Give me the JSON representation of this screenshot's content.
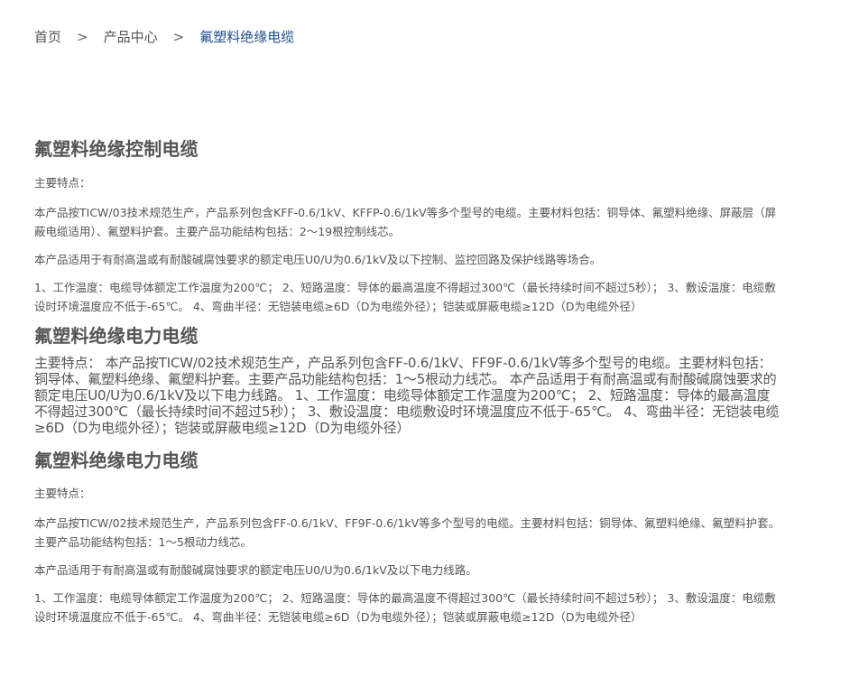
{
  "breadcrumb": {
    "home": "首页",
    "separator1": ">",
    "products": "产品中心",
    "separator2": ">",
    "current": "氟塑料绝缘电缆"
  },
  "sections": [
    {
      "title": "氟塑料绝缘控制电缆",
      "lead": "主要特点：",
      "p1": "本产品按TICW/03技术规范生产，产品系列包含KFF-0.6/1kV、KFFP-0.6/1kV等多个型号的电缆。主要材料包括：铜导体、氟塑料绝缘、屏蔽层（屏蔽电缆适用）、氟塑料护套。主要产品功能结构包括：2～19根控制线芯。",
      "p2": "本产品适用于有耐高温或有耐酸碱腐蚀要求的额定电压U0/U为0.6/1kV及以下控制、监控回路及保护线路等场合。",
      "p3": "1、工作温度：电缆导体额定工作温度为200℃； 2、短路温度：导体的最高温度不得超过300℃（最长持续时间不超过5秒）； 3、敷设温度：电缆敷设时环境温度应不低于-65℃。 4、弯曲半径：无铠装电缆≥6D（D为电缆外径）；铠装或屏蔽电缆≥12D（D为电缆外径）"
    },
    {
      "title": "氟塑料绝缘电力电缆",
      "body": "主要特点： 本产品按TICW/02技术规范生产，产品系列包含FF-0.6/1kV、FF9F-0.6/1kV等多个型号的电缆。主要材料包括：铜导体、氟塑料绝缘、氟塑料护套。主要产品功能结构包括：1～5根动力线芯。 本产品适用于有耐高温或有耐酸碱腐蚀要求的额定电压U0/U为0.6/1kV及以下电力线路。 1、工作温度：电缆导体额定工作温度为200℃； 2、短路温度：导体的最高温度不得超过300℃（最长持续时间不超过5秒）； 3、敷设温度：电缆敷设时环境温度应不低于-65℃。 4、弯曲半径：无铠装电缆≥6D（D为电缆外径）；铠装或屏蔽电缆≥12D（D为电缆外径）"
    },
    {
      "title": "氟塑料绝缘电力电缆",
      "lead": "主要特点：",
      "p1": "本产品按TICW/02技术规范生产，产品系列包含FF-0.6/1kV、FF9F-0.6/1kV等多个型号的电缆。主要材料包括：铜导体、氟塑料绝缘、氟塑料护套。主要产品功能结构包括：1～5根动力线芯。",
      "p2": "本产品适用于有耐高温或有耐酸碱腐蚀要求的额定电压U0/U为0.6/1kV及以下电力线路。",
      "p3": "1、工作温度：电缆导体额定工作温度为200℃； 2、短路温度：导体的最高温度不得超过300℃（最长持续时间不超过5秒）； 3、敷设温度：电缆敷设时环境温度应不低于-65℃。 4、弯曲半径：无铠装电缆≥6D（D为电缆外径）；铠装或屏蔽电缆≥12D（D为电缆外径）"
    }
  ],
  "colors": {
    "text": "#555555",
    "breadcrumb_current": "#1f4d8c"
  }
}
